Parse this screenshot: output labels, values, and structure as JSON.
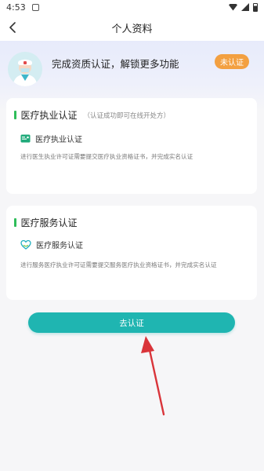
{
  "status_bar": {
    "time": "4:53",
    "icons": [
      "app-notification-icon",
      "wifi-icon",
      "signal-icon",
      "battery-icon"
    ]
  },
  "navbar": {
    "back_icon": "chevron-left-icon",
    "title": "个人资料"
  },
  "hero": {
    "avatar_icon": "doctor-avatar-icon",
    "message": "完成资质认证，解锁更多功能",
    "badge": "未认证",
    "badge_color": "#f3a041"
  },
  "sections": [
    {
      "title": "医疗执业认证",
      "hint": "（认证成功即可在线开处方）",
      "item": {
        "icon": "practice-license-icon",
        "label": "医疗执业认证",
        "description": "进行医生执业许可证需要提交医疗执业资格证书，并完成实名认证"
      }
    },
    {
      "title": "医疗服务认证",
      "hint": "",
      "item": {
        "icon": "medical-service-icon",
        "label": "医疗服务认证",
        "description": "进行服务医疗执业许可证需要提交服务医疗执业资格证书，并完成实名认证"
      }
    }
  ],
  "primary_button": {
    "label": "去认证",
    "color": "#1fb5b1"
  },
  "accent_colors": {
    "section_bar": "#2fbd5a",
    "annotation_arrow": "#d9343a"
  }
}
